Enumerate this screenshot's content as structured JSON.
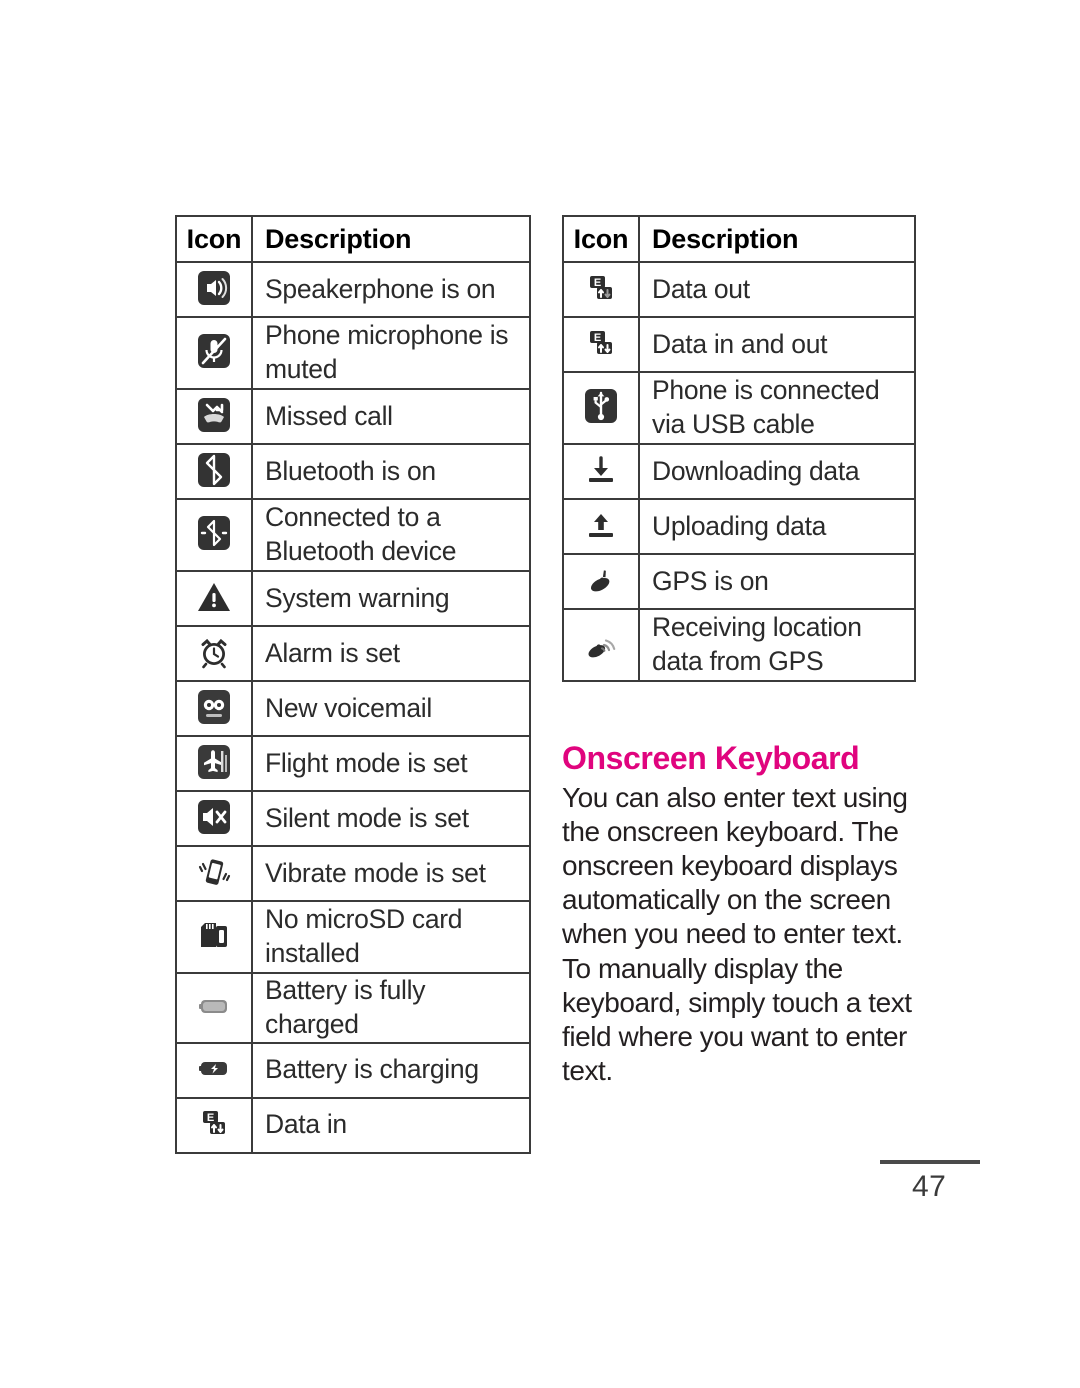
{
  "page": {
    "number": "47"
  },
  "tables": {
    "left": {
      "headers": {
        "icon": "Icon",
        "description": "Description"
      },
      "rows": [
        {
          "icon": "speakerphone-icon",
          "text": "Speakerphone is on",
          "lines": 1
        },
        {
          "icon": "microphone-muted-icon",
          "text": "Phone microphone is muted",
          "lines": 2
        },
        {
          "icon": "missed-call-icon",
          "text": "Missed call",
          "lines": 1
        },
        {
          "icon": "bluetooth-on-icon",
          "text": "Bluetooth is on",
          "lines": 1
        },
        {
          "icon": "bluetooth-connected-icon",
          "text": "Connected to a Bluetooth device",
          "lines": 2
        },
        {
          "icon": "system-warning-icon",
          "text": "System warning",
          "lines": 1
        },
        {
          "icon": "alarm-clock-icon",
          "text": "Alarm is set",
          "lines": 1
        },
        {
          "icon": "voicemail-icon",
          "text": "New voicemail",
          "lines": 1
        },
        {
          "icon": "flight-mode-icon",
          "text": "Flight mode is set",
          "lines": 1
        },
        {
          "icon": "silent-mode-icon",
          "text": "Silent mode is set",
          "lines": 1
        },
        {
          "icon": "vibrate-mode-icon",
          "text": "Vibrate mode is set",
          "lines": 1
        },
        {
          "icon": "no-microsd-card-icon",
          "text": "No microSD card installed",
          "lines": 2
        },
        {
          "icon": "battery-full-icon",
          "text": "Battery is fully charged",
          "lines": 1
        },
        {
          "icon": "battery-charging-icon",
          "text": "Battery is charging",
          "lines": 1
        },
        {
          "icon": "data-in-icon",
          "text": "Data in",
          "lines": 1
        }
      ]
    },
    "right": {
      "headers": {
        "icon": "Icon",
        "description": "Description"
      },
      "rows": [
        {
          "icon": "data-out-icon",
          "text": "Data out",
          "lines": 1
        },
        {
          "icon": "data-in-and-out-icon",
          "text": "Data in and out",
          "lines": 1
        },
        {
          "icon": "usb-connected-icon",
          "text": "Phone is connected via USB cable",
          "lines": 2
        },
        {
          "icon": "downloading-data-icon",
          "text": "Downloading data",
          "lines": 1
        },
        {
          "icon": "uploading-data-icon",
          "text": "Uploading data",
          "lines": 1
        },
        {
          "icon": "gps-on-icon",
          "text": "GPS is on",
          "lines": 1
        },
        {
          "icon": "gps-receiving-icon",
          "text": "Receiving location data from GPS",
          "lines": 2
        }
      ]
    }
  },
  "article": {
    "heading": "Onscreen Keyboard",
    "body": "You can also enter text using the onscreen keyboard. The onscreen keyboard displays automatically on the screen when you need to enter text. To manually display the keyboard, simply touch a text field where you want to enter text."
  },
  "colors": {
    "heading_pink": "#e0047e",
    "table_border": "#3b3b3b",
    "body_text": "#231f20"
  }
}
